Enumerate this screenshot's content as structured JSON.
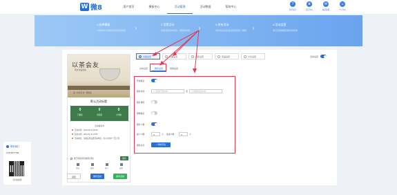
{
  "brand": {
    "mark": "W",
    "name": "微8"
  },
  "nav": [
    "用户首页",
    "模板中心",
    "活动管理",
    "活动数据",
    "帮助中心"
  ],
  "tools": [
    {
      "icon": "help-icon",
      "label": "新手指引"
    },
    {
      "icon": "crown-icon",
      "label": "会员中心"
    },
    {
      "icon": "chat-icon",
      "label": "联系客服"
    },
    {
      "icon": "user-icon",
      "label": "个人中心"
    }
  ],
  "steps": [
    {
      "title": "1.选择模板",
      "desc": "从模板中心选择合适的活动模板"
    },
    {
      "title": "2.设置活动",
      "desc": "设置活动基本信息、规则等内容"
    },
    {
      "title": "3.发布活动",
      "desc": "发布活动后生成活动链接和二维码"
    },
    {
      "title": "4.活动运营",
      "desc": "通过活动数据查看活动效果"
    }
  ],
  "template_tabs": [
    "基础设置",
    "页面设置",
    "报名设置",
    "奖品设置",
    "分享设置"
  ],
  "top_toggle_label": "活动设置",
  "sub_tabs": [
    "基本设置",
    "报名设置",
    "其他设置"
  ],
  "form": {
    "enable_label": "开启报名",
    "time_label": "报名时间",
    "start_placeholder": "请选择开始时间",
    "end_placeholder": "请选择结束时间",
    "date_sep": "至",
    "audit_label": "报名审核",
    "limit_label": "限制报名",
    "count_label": "报名人数",
    "min_label": "最少人数",
    "min_value": "0",
    "max_label": "最多人数",
    "max_value": "0",
    "unit": "人",
    "field_label": "报名信息",
    "add_button": "+ 添加字段"
  },
  "preview": {
    "poster_title": "以茶会友",
    "poster_sub": "茶文化品鉴会",
    "poster_foot": "品一杯好茶 交一群朋友",
    "heading": "默认活动标题",
    "stats": [
      {
        "num": "0",
        "label": "已报名"
      },
      {
        "num": "0",
        "label": "浏览量"
      },
      {
        "num": "0",
        "label": "分享数"
      }
    ],
    "progress": "活动报名中",
    "info": [
      "活动时间：2024-01-01 00:00",
      "结束时间：2024-01-31 23:59",
      "活动地点：请在后台设置活动地点，可以让用户一目了然"
    ],
    "join_text": "我已阅读并同意报名须知",
    "join_button": "报名",
    "bottom_nav": [
      "首页",
      "我的",
      "排行",
      "更多"
    ]
  },
  "actions": {
    "back": "返回",
    "save": "保存活动",
    "publish": "发布活动"
  },
  "sidebar": {
    "title": "联系我们",
    "phone": "17673277765",
    "caption": "扫码加客服"
  }
}
